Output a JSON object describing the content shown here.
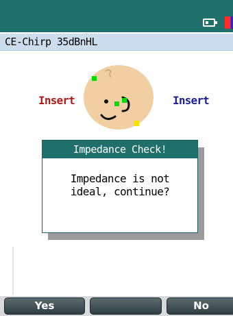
{
  "title": "CE-Chirp 35dBnHL",
  "labels": {
    "left": "Insert",
    "right": "Insert"
  },
  "dialog": {
    "header": "Impedance Check!",
    "line1": "Impedance is not",
    "line2": "ideal, continue?"
  },
  "softkeys": {
    "left": "Yes",
    "center": "",
    "right": "No"
  },
  "colors": {
    "status_bar": "#1f6f6b",
    "title_bar": "#ccdeee",
    "left_label": "#b51a1a",
    "right_label": "#1a1f9c",
    "electrode_good": "#00dd00",
    "electrode_warn": "#f2e400"
  }
}
